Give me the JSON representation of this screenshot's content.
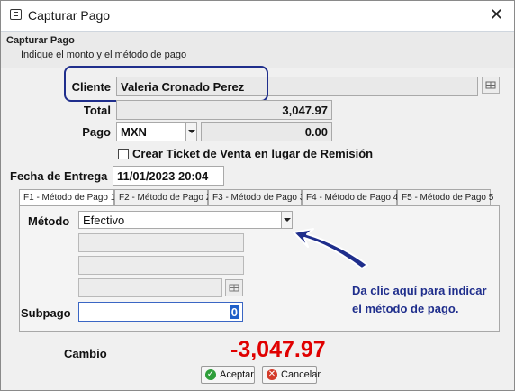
{
  "window": {
    "title": "Capturar Pago",
    "close_icon": "close-icon"
  },
  "header": {
    "title": "Capturar Pago",
    "subtitle": "Indique el monto y el método de pago"
  },
  "form": {
    "cliente_label": "Cliente",
    "cliente_value": "Valeria Cronado Perez",
    "total_label": "Total",
    "total_value": "3,047.97",
    "pago_label": "Pago",
    "currency_value": "MXN",
    "amount_value": "0.00",
    "ticket_checkbox_label": "Crear Ticket de Venta en lugar de Remisión",
    "ticket_checked": false,
    "fecha_label": "Fecha de Entrega",
    "fecha_value": "11/01/2023 20:04"
  },
  "tabs": [
    {
      "label": "F1 - Método de Pago 1",
      "active": true
    },
    {
      "label": "F2 - Método de Pago 2",
      "active": false
    },
    {
      "label": "F3 - Método de Pago 3",
      "active": false
    },
    {
      "label": "F4 - Método de Pago 4",
      "active": false
    },
    {
      "label": "F5 - Método de Pago 5",
      "active": false
    }
  ],
  "payment": {
    "metodo_label": "Método",
    "metodo_value": "Efectivo",
    "subpago_label": "Subpago",
    "subpago_value": "0"
  },
  "annotation": {
    "line1": "Da clic aquí para indicar",
    "line2": "el método de pago."
  },
  "footer": {
    "cambio_label": "Cambio",
    "cambio_value": "-3,047.97",
    "accept_label": "Aceptar",
    "cancel_label": "Cancelar"
  },
  "colors": {
    "annotation": "#1f2e8c",
    "cambio": "#e00000",
    "accept_icon": "#2e9e3a",
    "cancel_icon": "#d43b2a"
  }
}
